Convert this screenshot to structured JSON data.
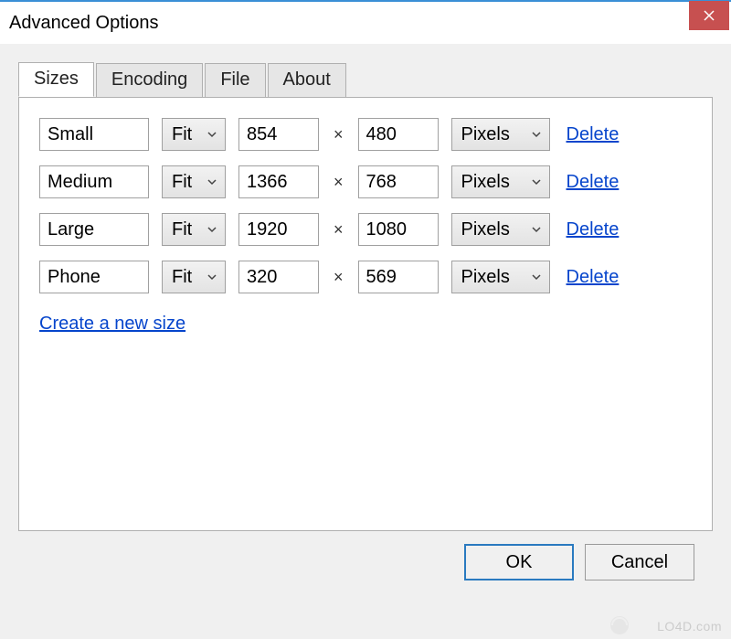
{
  "window": {
    "title": "Advanced Options"
  },
  "tabs": {
    "items": [
      {
        "label": "Sizes"
      },
      {
        "label": "Encoding"
      },
      {
        "label": "File"
      },
      {
        "label": "About"
      }
    ],
    "active_index": 0
  },
  "sizes": {
    "fit_label": "Fit",
    "unit_label": "Pixels",
    "times": "×",
    "delete_label": "Delete",
    "rows": [
      {
        "name": "Small",
        "width": "854",
        "height": "480"
      },
      {
        "name": "Medium",
        "width": "1366",
        "height": "768"
      },
      {
        "name": "Large",
        "width": "1920",
        "height": "1080"
      },
      {
        "name": "Phone",
        "width": "320",
        "height": "569"
      }
    ],
    "create_link": "Create a new size"
  },
  "buttons": {
    "ok": "OK",
    "cancel": "Cancel"
  },
  "watermark": "LO4D.com"
}
